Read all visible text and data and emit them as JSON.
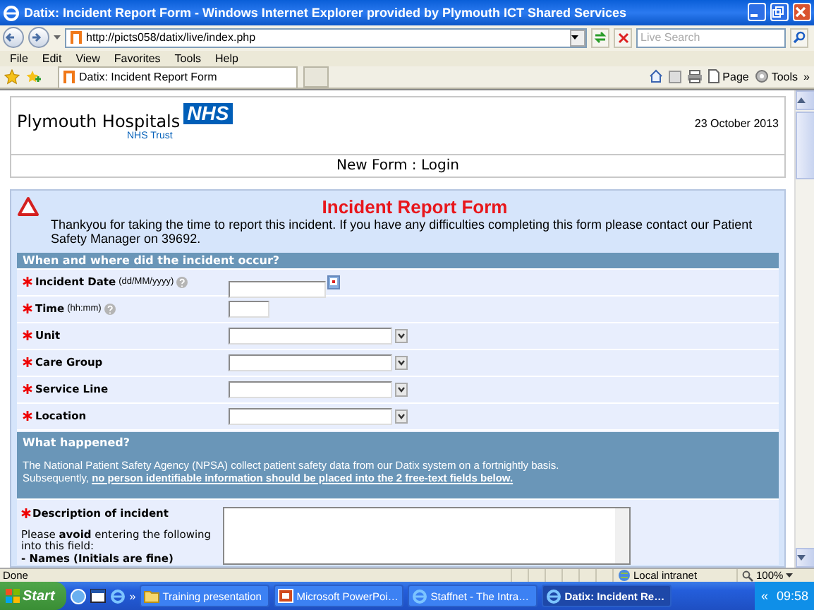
{
  "window": {
    "title": "Datix: Incident Report Form - Windows Internet Explorer provided by Plymouth ICT Shared Services"
  },
  "address_bar": {
    "url": "http://picts058/datix/live/index.php",
    "search_placeholder": "Live Search"
  },
  "menu": [
    "File",
    "Edit",
    "View",
    "Favorites",
    "Tools",
    "Help"
  ],
  "tab": {
    "label": "Datix: Incident Report Form"
  },
  "command_bar": [
    "Page",
    "Tools",
    "»"
  ],
  "header": {
    "hospital": "Plymouth Hospitals",
    "badge": "NHS",
    "trust": "NHS Trust",
    "date": "23 October 2013",
    "nav": "New Form : Login"
  },
  "intro": {
    "title": "Incident Report Form",
    "text": "Thankyou for taking the time to report this incident. If you have any difficulties completing this form please contact our Patient Safety Manager on 39692."
  },
  "section": {
    "heading": "When and where did the incident occur?",
    "fields": [
      {
        "label": "Incident Date",
        "hint": "(dd/MM/yyyy)",
        "help": true,
        "required": true,
        "kind": "date"
      },
      {
        "label": "Time",
        "hint": "(hh:mm)",
        "help": true,
        "required": true,
        "kind": "time"
      },
      {
        "label": "Unit",
        "required": true,
        "kind": "select"
      },
      {
        "label": "Care Group",
        "required": true,
        "kind": "select"
      },
      {
        "label": "Service Line",
        "required": true,
        "kind": "select"
      },
      {
        "label": "Location",
        "required": true,
        "kind": "select"
      }
    ]
  },
  "notice": {
    "heading": "What happened?",
    "lines": [
      "The National Patient Safety Agency (NPSA) collect patient safety data from our Datix system on a fortnightly basis.",
      "Subsequently, **no person identifiable information should be placed into the 2 free-text fields below.**"
    ]
  },
  "description": {
    "label": "Description of incident",
    "required": true,
    "note": "Please **avoid** entering the following into this field:",
    "items": [
      "- Names (Initials are fine)"
    ]
  },
  "status_bar": {
    "text": "Done",
    "zone": "Local intranet",
    "zoom": "100%"
  },
  "taskbar": {
    "start": "Start",
    "more": "»",
    "tasks": [
      {
        "label": "Training presentation",
        "selected": false
      },
      {
        "label": "Microsoft PowerPoi…",
        "selected": false
      },
      {
        "label": "Staffnet - The Intra…",
        "selected": false
      },
      {
        "label": "Datix: Incident Re…",
        "selected": true
      }
    ],
    "tray_toggle": "«",
    "clock": "09:58"
  }
}
